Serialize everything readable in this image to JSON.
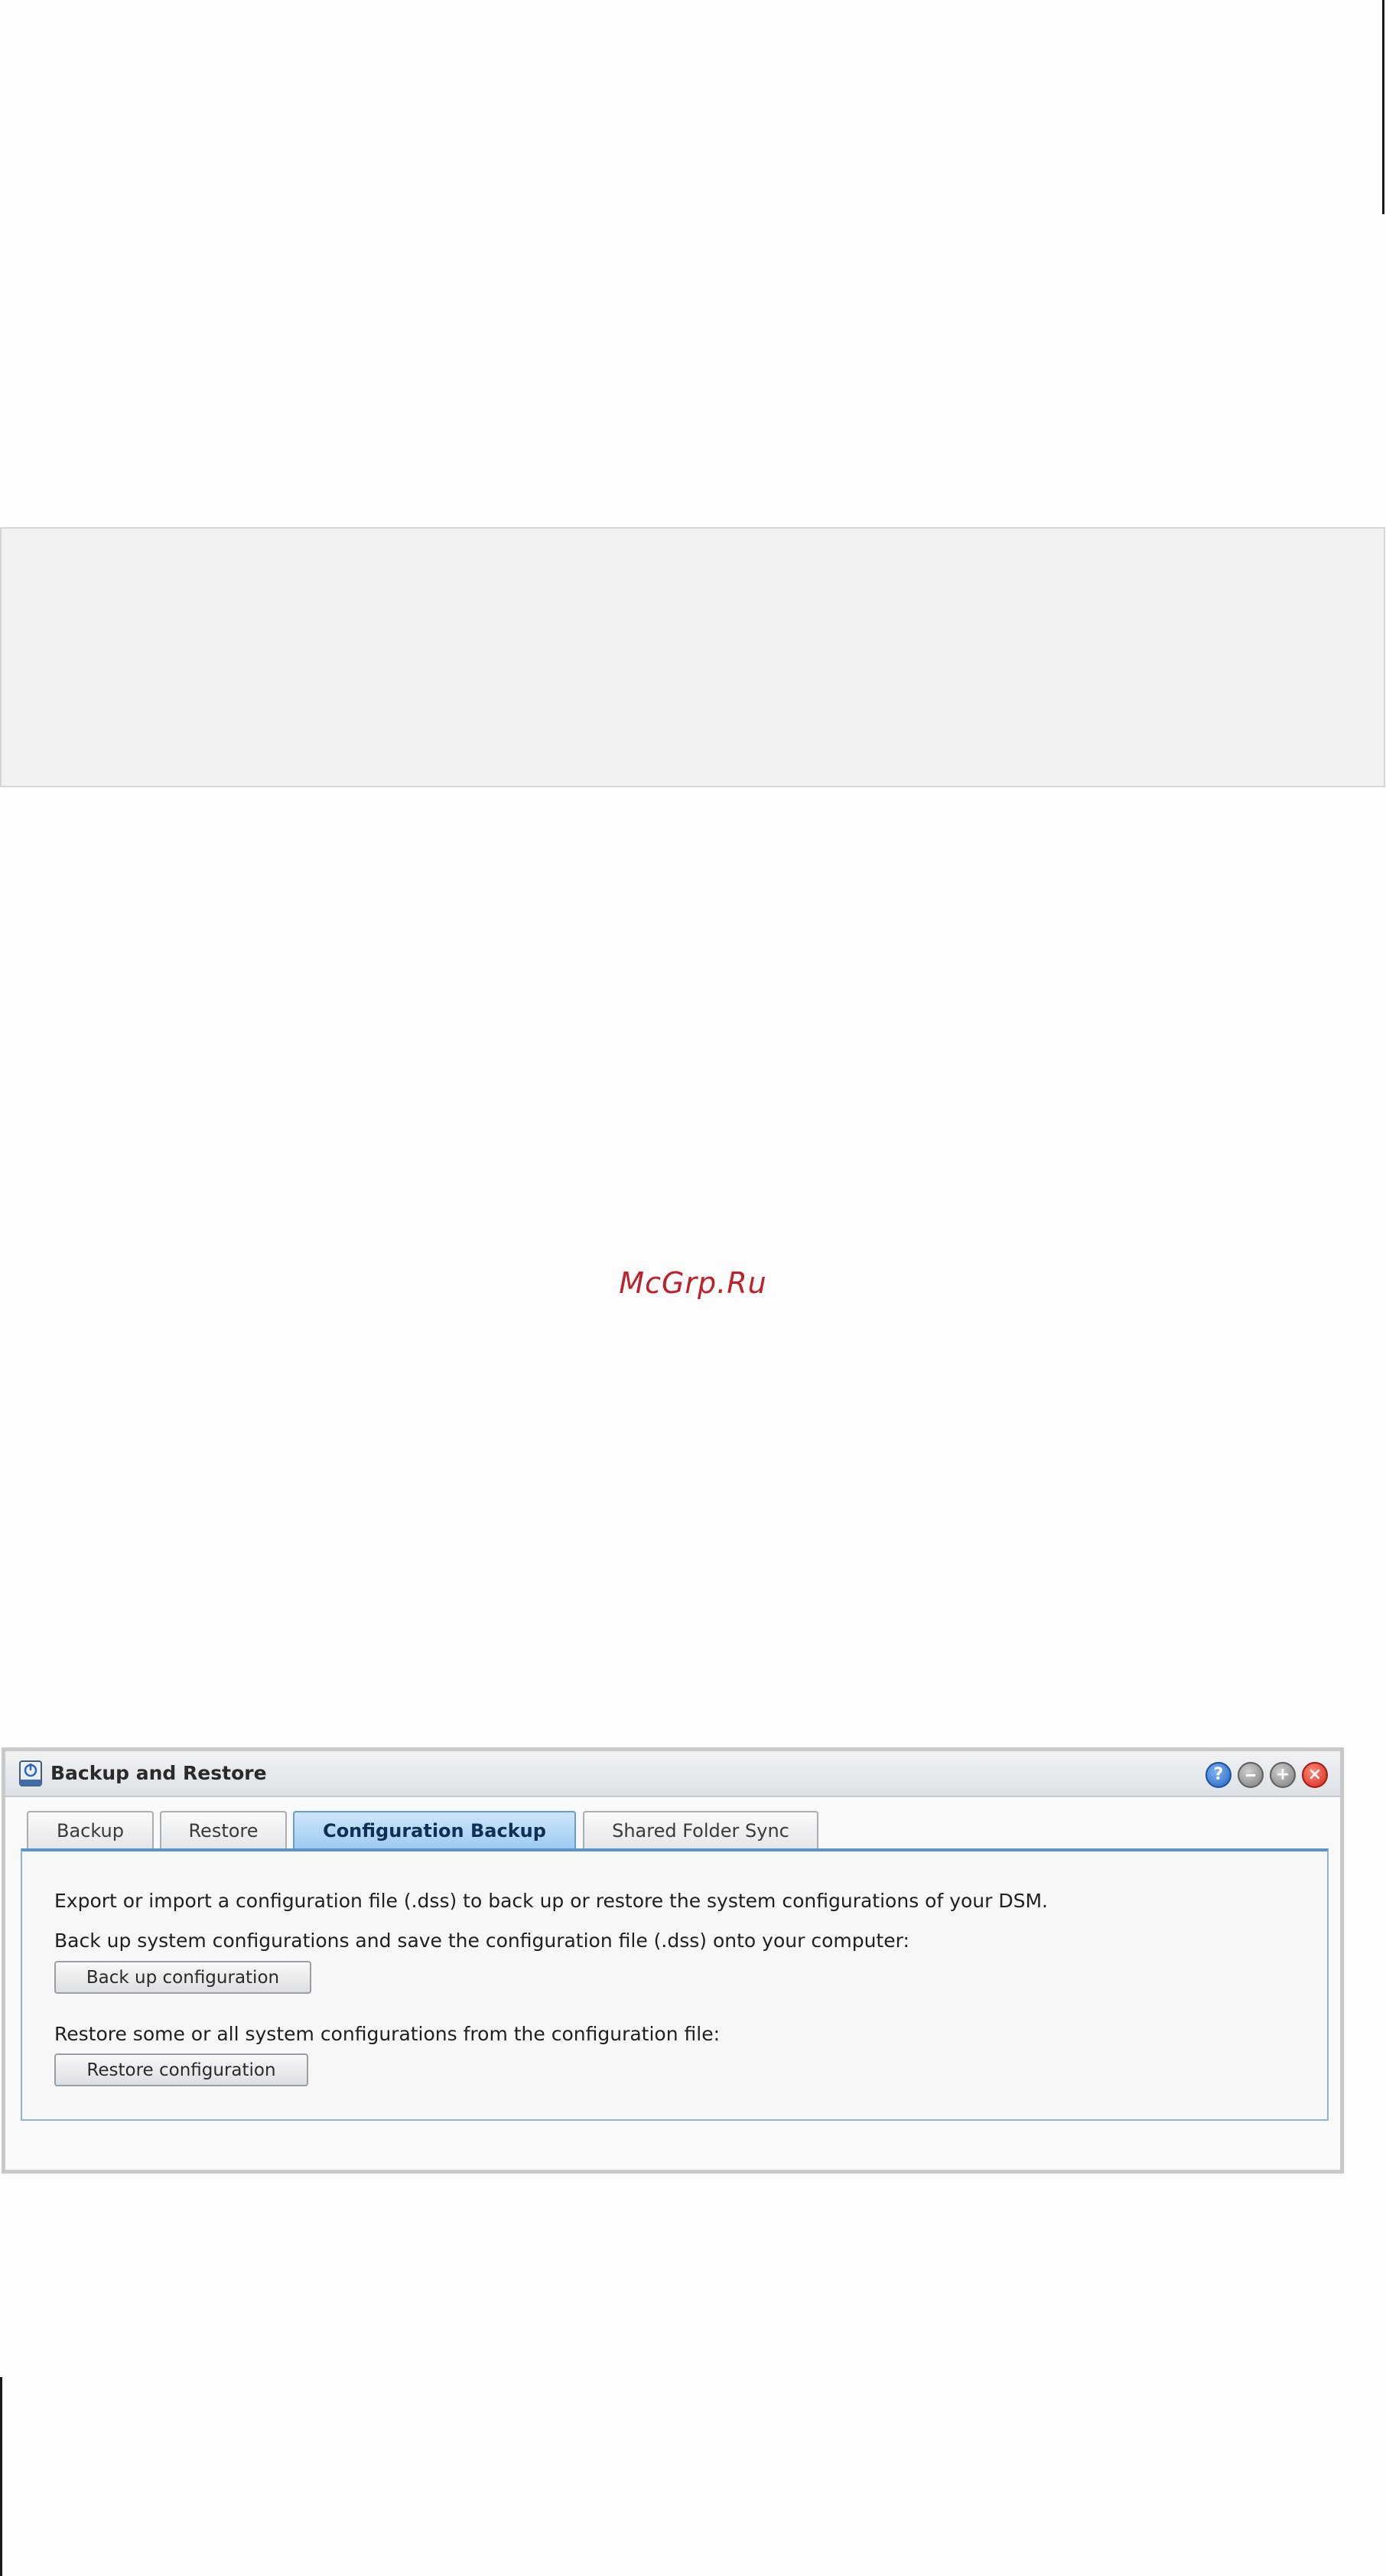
{
  "watermark": "McGrp.Ru",
  "window": {
    "title": "Backup and Restore",
    "icons": {
      "app": "backup-app-icon",
      "help": "help-icon",
      "minimize": "minimize-icon",
      "maximize": "maximize-icon",
      "close": "close-icon"
    },
    "help_glyph": "?",
    "max_glyph": "+",
    "close_glyph": "×",
    "accent_color": "#5f94c8"
  },
  "tabs": [
    {
      "label": "Backup",
      "active": false
    },
    {
      "label": "Restore",
      "active": false
    },
    {
      "label": "Configuration Backup",
      "active": true
    },
    {
      "label": "Shared Folder Sync",
      "active": false
    }
  ],
  "panel": {
    "intro": "Export or import a configuration file (.dss) to back up or restore the system configurations of your DSM.",
    "backup_prompt": "Back up system configurations and save the configuration file (.dss) onto your computer:",
    "backup_button": "Back up configuration",
    "restore_prompt": "Restore some or all system configurations from the configuration file:",
    "restore_button": "Restore configuration"
  }
}
